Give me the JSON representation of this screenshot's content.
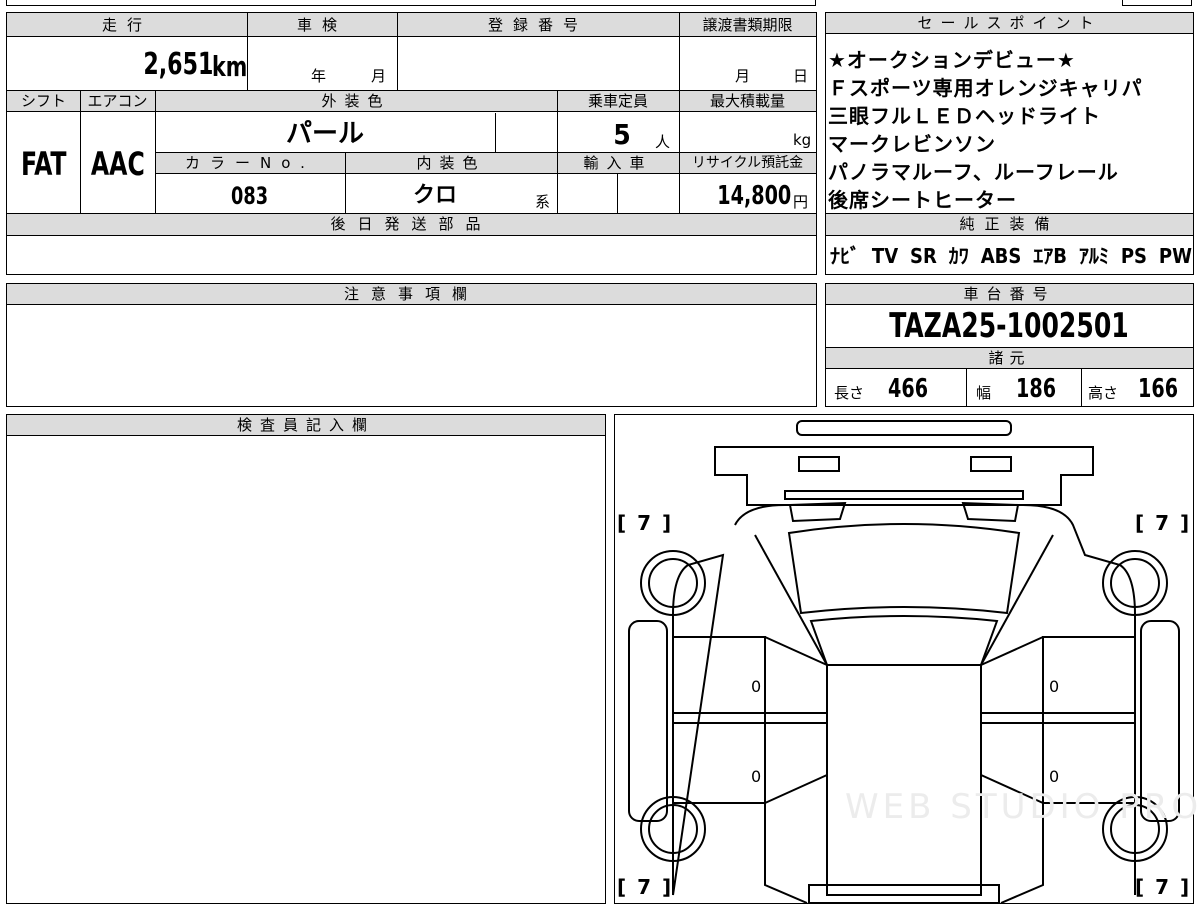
{
  "sheet": {
    "mileage": {
      "header": "走行",
      "value": "2,651",
      "unit": "km"
    },
    "inspection": {
      "header": "車検",
      "year_label": "年",
      "month_label": "月"
    },
    "registration": {
      "header": "登録番号"
    },
    "transfer_deadline": {
      "header": "譲渡書類期限",
      "month_label": "月",
      "day_label": "日"
    },
    "shift": {
      "header": "シフト",
      "value": "FAT"
    },
    "aircon": {
      "header": "エアコン",
      "value": "AAC"
    },
    "exterior_color": {
      "header": "外装色",
      "value": "パール"
    },
    "capacity": {
      "header": "乗車定員",
      "value": "5",
      "unit": "人"
    },
    "max_load": {
      "header": "最大積載量",
      "unit": "kg"
    },
    "color_no": {
      "header": "カラーNo.",
      "value": "083"
    },
    "interior_color": {
      "header": "内装色",
      "value": "クロ",
      "suffix": "系"
    },
    "import": {
      "header": "輸入車"
    },
    "recycle_fee": {
      "header": "リサイクル預託金",
      "value": "14,800",
      "unit": "円"
    },
    "later_parts": {
      "header": "後日発送部品"
    },
    "notes": {
      "header": "注意事項欄"
    },
    "inspector": {
      "header": "検査員記入欄"
    }
  },
  "sales_points": {
    "header": "セールスポイント",
    "lines": [
      "★オークションデビュー★",
      "Ｆスポーツ専用オレンジキャリパ",
      "三眼フルＬＥＤヘッドライト",
      "マークレビンソン",
      "パノラマルーフ、ルーフレール",
      "後席シートヒーター"
    ]
  },
  "equipment": {
    "header": "純正装備",
    "items": [
      "ﾅﾋﾞ",
      "TV",
      "SR",
      "ｶﾜ",
      "ABS",
      "ｴｱB",
      "ｱﾙﾐ",
      "PS",
      "PW"
    ]
  },
  "chassis": {
    "header": "車台番号",
    "value": "TAZA25-1002501"
  },
  "specs": {
    "header": "諸元",
    "length_label": "長さ",
    "length": "466",
    "width_label": "幅",
    "width": "186",
    "height_label": "高さ",
    "height": "166"
  },
  "diagram": {
    "tire_top_left": "[ 7 ]",
    "tire_top_right": "[ 7 ]",
    "tire_bottom_left": "[ 7 ]",
    "tire_bottom_right": "[ 7 ]",
    "door_marks": [
      "0",
      "0",
      "0",
      "0"
    ]
  },
  "watermark": "WEB STUDIO PRO"
}
